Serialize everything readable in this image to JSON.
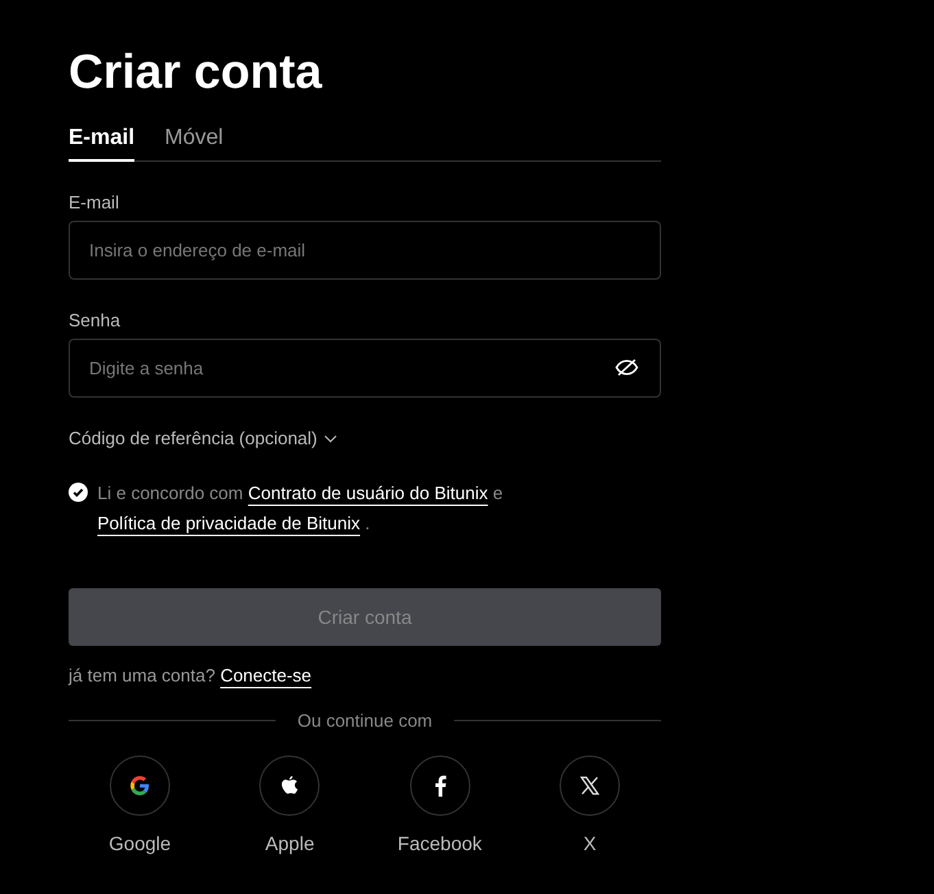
{
  "title": "Criar conta",
  "tabs": [
    {
      "label": "E-mail",
      "selected": true
    },
    {
      "label": "Móvel",
      "selected": false
    }
  ],
  "fields": [
    {
      "label": "E-mail",
      "placeholder": "Insira o endereço de e-mail",
      "kind": "email"
    },
    {
      "label": "Senha",
      "placeholder": "Digite a senha",
      "kind": "password"
    }
  ],
  "referral": {
    "label": "Código de referência (opcional)",
    "expanded": false
  },
  "agreement": {
    "checked": true,
    "parts": [
      {
        "kind": "text",
        "text": "Li e concordo com"
      },
      {
        "kind": "link",
        "text": "Contrato de usuário do Bitunix"
      },
      {
        "kind": "text",
        "text": "e"
      },
      {
        "kind": "link",
        "text": "Política de privacidade de Bitunix"
      },
      {
        "kind": "text",
        "text": "."
      }
    ]
  },
  "submit": {
    "label": "Criar conta",
    "disabled": true
  },
  "login": {
    "prompt": "já tem uma conta?",
    "link": "Conecte-se"
  },
  "divider": "Ou continue com",
  "social": [
    {
      "kind": "google",
      "label": "Google"
    },
    {
      "kind": "apple",
      "label": "Apple"
    },
    {
      "kind": "facebook",
      "label": "Facebook"
    },
    {
      "kind": "x",
      "label": "X"
    }
  ]
}
